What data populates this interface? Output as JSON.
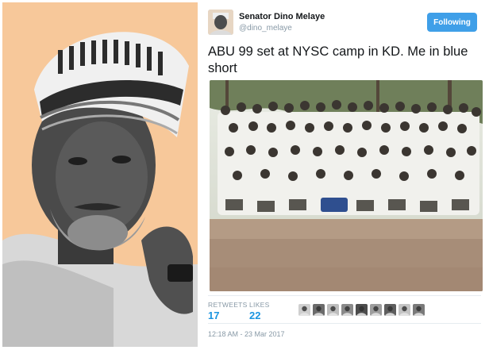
{
  "tweet": {
    "author_name": "Senator Dino Melaye",
    "author_handle": "@dino_melaye",
    "follow_button_label": "Following",
    "text": "ABU 99 set at NYSC camp in KD. Me in blue short",
    "stats": {
      "retweets_label": "RETWEETS",
      "retweets_count": "17",
      "likes_label": "LIKES",
      "likes_count": "22"
    },
    "liker_avatar_count": 9,
    "timestamp": "12:18 AM - 23 Mar 2017"
  },
  "colors": {
    "accent": "#3f9fe8",
    "stat_value": "#1b95e0",
    "portrait_background": "#f7c89a",
    "muted_text": "#8899a6"
  },
  "icons": {
    "portrait": "person-portrait-illustration",
    "avatar": "user-avatar",
    "photo": "group-photo",
    "liker": "user-avatar-small"
  }
}
